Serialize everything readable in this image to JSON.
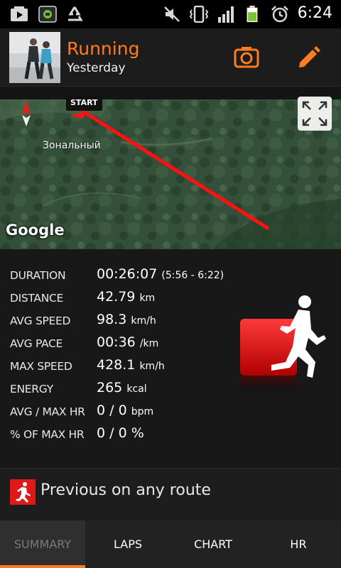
{
  "status_bar": {
    "time": "6:24",
    "icons": [
      "youtube-icon",
      "app-icon",
      "recycle-icon",
      "mute-icon",
      "vibrate-icon",
      "signal-icon",
      "battery-icon",
      "alarm-icon"
    ]
  },
  "header": {
    "title": "Running",
    "subtitle": "Yesterday",
    "icons": [
      "camera-icon",
      "edit-icon"
    ],
    "accent_color": "#ff7d1e"
  },
  "map": {
    "place_name": "Зональный",
    "provider": "Google",
    "start_label": "START",
    "route_color": "#ff1111"
  },
  "stats": [
    {
      "label": "DURATION",
      "value": "00:26:07",
      "unit": "(5:56 - 6:22)"
    },
    {
      "label": "DISTANCE",
      "value": "42.79",
      "unit": "km"
    },
    {
      "label": "AVG SPEED",
      "value": "98.3",
      "unit": "km/h"
    },
    {
      "label": "AVG PACE",
      "value": "00:36",
      "unit": "/km"
    },
    {
      "label": "MAX SPEED",
      "value": "428.1",
      "unit": "km/h"
    },
    {
      "label": "ENERGY",
      "value": "265",
      "unit": "kcal"
    },
    {
      "label": "AVG / MAX HR",
      "value": "0 / 0",
      "unit": "bpm"
    },
    {
      "label": "% OF MAX HR",
      "value": "0 / 0 %",
      "unit": ""
    }
  ],
  "previous_route": {
    "label": "Previous on any route"
  },
  "tabs": [
    {
      "label": "SUMMARY",
      "active": true
    },
    {
      "label": "LAPS",
      "active": false
    },
    {
      "label": "CHART",
      "active": false
    },
    {
      "label": "HR",
      "active": false
    }
  ]
}
